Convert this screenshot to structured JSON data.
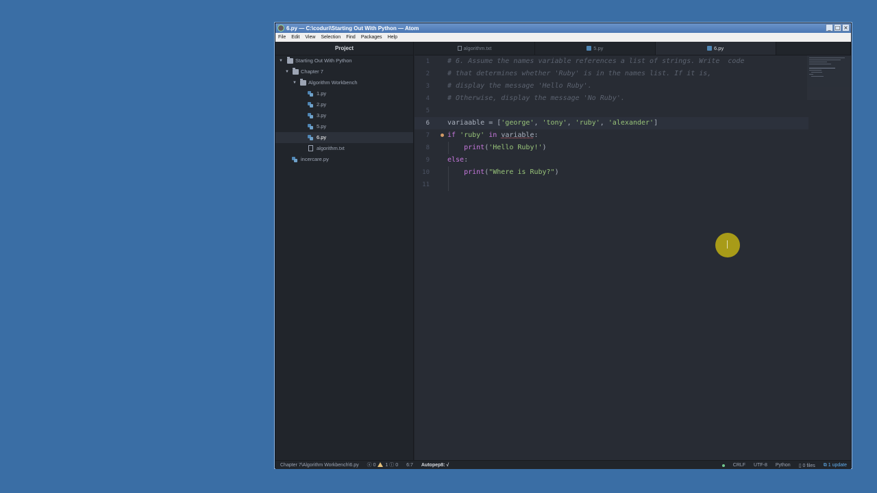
{
  "window": {
    "title": "6.py — C:\\coduri\\Starting Out With Python — Atom",
    "controls": [
      "_",
      "□",
      "×"
    ]
  },
  "menubar": [
    "File",
    "Edit",
    "View",
    "Selection",
    "Find",
    "Packages",
    "Help"
  ],
  "tree": {
    "header": "Project",
    "root": "Starting Out With Python",
    "chapter": "Chapter 7",
    "subfolder": "Algorithm Workbench",
    "files": [
      "1.py",
      "2.py",
      "3.py",
      "5.py",
      "6.py",
      "algorithm.txt"
    ],
    "selected": "6.py",
    "extra_file": "incercare.py"
  },
  "tabs": [
    {
      "label": "algorithm.txt",
      "icon": "text-file-icon"
    },
    {
      "label": "5.py",
      "icon": "python-file-icon"
    },
    {
      "label": "6.py",
      "icon": "python-file-icon",
      "active": true
    }
  ],
  "editor": {
    "line_numbers": [
      "1",
      "2",
      "3",
      "4",
      "5",
      "6",
      "7",
      "8",
      "9",
      "10",
      "11"
    ],
    "lines": {
      "l1": "# 6. Assume the names variable references a list of strings. Write  code",
      "l2": "# that determines whether 'Ruby' is in the names list. If it is,",
      "l3": "# display the message 'Hello Ruby'.",
      "l4": "# Otherwise, display the message 'No Ruby'.",
      "l6_a": "variaable = [",
      "l6_s1": "'george'",
      "l6_c1": ", ",
      "l6_s2": "'tony'",
      "l6_c2": ", ",
      "l6_s3": "'ruby'",
      "l6_c3": ", ",
      "l6_s4": "'alexander'",
      "l6_b": "]",
      "l7_kw": "if",
      "l7_s": "'ruby'",
      "l7_in": "in",
      "l7_var": "variable",
      "l7_colon": ":",
      "l8_fn": "print",
      "l8_open": "(",
      "l8_s": "'Hello Ruby!'",
      "l8_close": ")",
      "l9_kw": "else",
      "l9_colon": ":",
      "l10_fn": "print",
      "l10_open": "(",
      "l10_s": "\"Where is Ruby?\"",
      "l10_close": ")"
    }
  },
  "statusbar": {
    "path": "Chapter 7\\Algorithm Workbench\\6.py",
    "errors": "0",
    "warnings": "1",
    "infos": "0",
    "position": "6:7",
    "autopep": "Autopep8: √",
    "line_ending": "CRLF",
    "encoding": "UTF-8",
    "grammar": "Python",
    "files": "0 files",
    "update": "1 update"
  },
  "colors": {
    "desktop": "#3a6ea5",
    "editor_bg": "#282c34",
    "panel_bg": "#21252b",
    "string": "#98c379",
    "keyword": "#c678dd",
    "comment": "#5c6370",
    "cursor_highlight": "#bea f14"
  }
}
